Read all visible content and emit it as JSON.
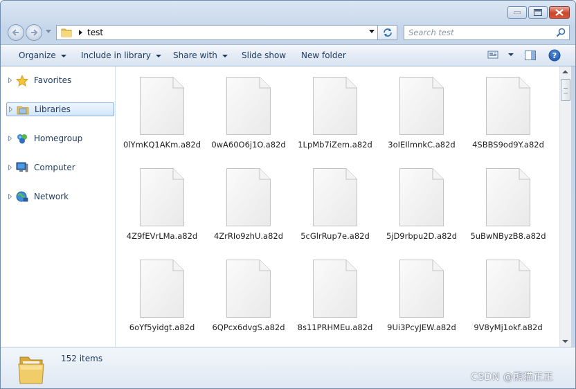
{
  "window": {
    "address_path": "test",
    "search_placeholder": "Search test",
    "caption_buttons": [
      "minimize",
      "maximize",
      "close"
    ]
  },
  "commands": {
    "organize": "Organize",
    "include_in_library": "Include in library",
    "share_with": "Share with",
    "slide_show": "Slide show",
    "new_folder": "New folder"
  },
  "nav_pane": {
    "items": [
      {
        "label": "Favorites",
        "icon": "star-icon"
      },
      {
        "label": "Libraries",
        "icon": "libraries-icon",
        "selected": true
      },
      {
        "label": "Homegroup",
        "icon": "homegroup-icon"
      },
      {
        "label": "Computer",
        "icon": "computer-icon"
      },
      {
        "label": "Network",
        "icon": "network-icon"
      }
    ]
  },
  "files": [
    "0lYmKQ1AKm.a82d",
    "0wA60O6j1O.a82d",
    "1LpMb7iZem.a82d",
    "3oIEIlmnkC.a82d",
    "4SBBS9od9Y.a82d",
    "4Z9fEVrLMa.a82d",
    "4ZrRIo9zhU.a82d",
    "5cGlrRup7e.a82d",
    "5jD9rbpu2D.a82d",
    "5uBwNByzB8.a82d",
    "6oYf5yidgt.a82d",
    "6QPcx6dvgS.a82d",
    "8s11PRHMEu.a82d",
    "9Ui3PcyJEW.a82d",
    "9V8yMj1okf.a82d"
  ],
  "details": {
    "item_count": "152 items"
  },
  "watermark": "CSDN @熊猫正正",
  "colors": {
    "text": "#1e395b",
    "selection": "#d3e6fb",
    "close_button": "#c9462c"
  }
}
